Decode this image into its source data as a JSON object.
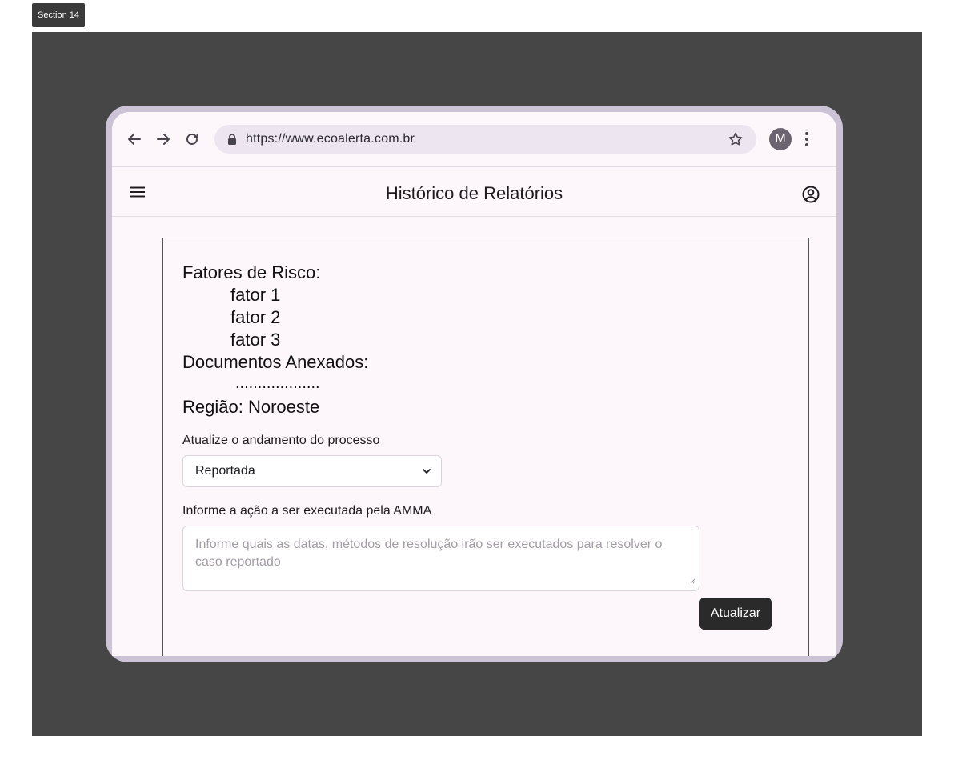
{
  "section_label": "Section 14",
  "browser": {
    "url": "https://www.ecoalerta.com.br",
    "avatar_initial": "M"
  },
  "app": {
    "title": "Histórico de Relatórios"
  },
  "report": {
    "risk_factors_label": "Fatores de Risco:",
    "risk_factors": [
      "fator 1",
      "fator 2",
      "fator 3"
    ],
    "documents_label": "Documentos Anexados:",
    "documents_placeholder": "...................",
    "region_line": "Região: Noroeste"
  },
  "form": {
    "status_label": "Atualize o andamento do processo",
    "status_value": "Reportada",
    "action_label": "Informe a ação a ser executada pela AMMA",
    "action_placeholder": "Informe quais as datas, métodos de resolução irão ser executados para resolver o caso reportado",
    "submit_label": "Atualizar"
  }
}
